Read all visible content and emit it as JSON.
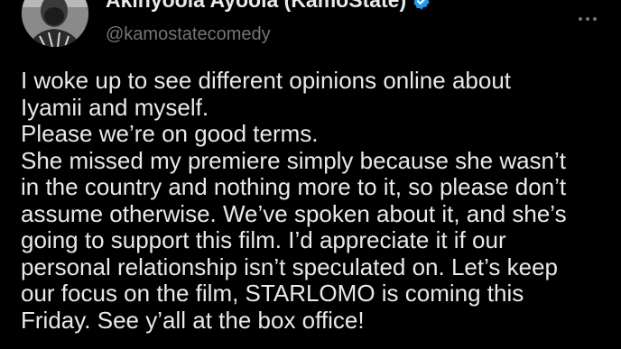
{
  "author": {
    "display_name": "Akinyoola Ayoola (KamoState)",
    "handle": "@kamostatecomedy",
    "verified_icon": "verified-badge-icon",
    "verified_color": "#1d9bf0"
  },
  "menu": {
    "icon": "more-options-icon"
  },
  "tweet": {
    "lines": [
      "I woke up to see different opinions online about",
      "Iyamii and myself.",
      "Please we’re on good terms.",
      "She missed my premiere simply because she wasn’t",
      "in the country and nothing more to it, so please don’t",
      "assume otherwise. We’ve spoken about it, and she’s",
      "going to support this film. I’d appreciate it if our",
      "personal relationship isn’t speculated on. Let’s keep",
      "our focus on the film, STARLOMO is coming this",
      "Friday. See y’all at the box office!"
    ]
  },
  "colors": {
    "background": "#000000",
    "primary_text": "#e7e9ea",
    "secondary_text": "#71767b"
  }
}
